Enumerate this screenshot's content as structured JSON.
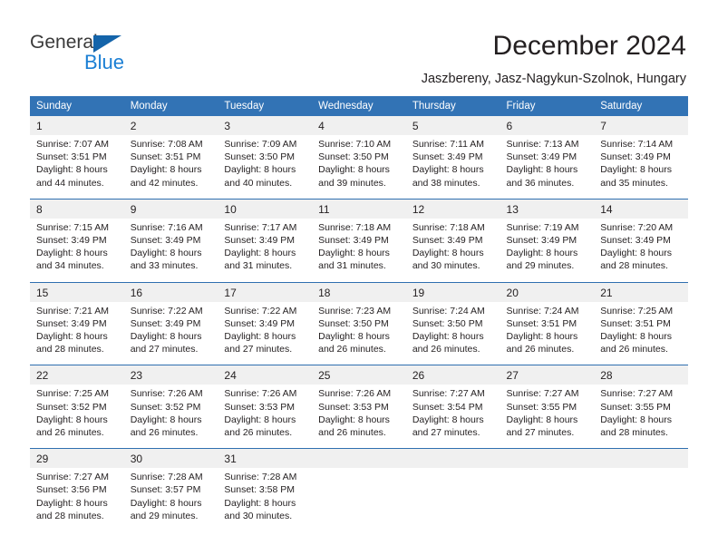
{
  "brand": {
    "name_part1": "General",
    "name_part2": "Blue",
    "triangle_color": "#1464aa",
    "blue_color": "#1b7fd4"
  },
  "header": {
    "title": "December 2024",
    "subtitle": "Jaszbereny, Jasz-Nagykun-Szolnok, Hungary"
  },
  "theme": {
    "header_bg": "#3273b5",
    "daynum_bg": "#f0f0f0",
    "rule_color": "#2f6fb0"
  },
  "calendar": {
    "weekdays": [
      "Sunday",
      "Monday",
      "Tuesday",
      "Wednesday",
      "Thursday",
      "Friday",
      "Saturday"
    ],
    "weeks": [
      [
        {
          "day": "1",
          "sunrise": "Sunrise: 7:07 AM",
          "sunset": "Sunset: 3:51 PM",
          "daylight1": "Daylight: 8 hours",
          "daylight2": "and 44 minutes."
        },
        {
          "day": "2",
          "sunrise": "Sunrise: 7:08 AM",
          "sunset": "Sunset: 3:51 PM",
          "daylight1": "Daylight: 8 hours",
          "daylight2": "and 42 minutes."
        },
        {
          "day": "3",
          "sunrise": "Sunrise: 7:09 AM",
          "sunset": "Sunset: 3:50 PM",
          "daylight1": "Daylight: 8 hours",
          "daylight2": "and 40 minutes."
        },
        {
          "day": "4",
          "sunrise": "Sunrise: 7:10 AM",
          "sunset": "Sunset: 3:50 PM",
          "daylight1": "Daylight: 8 hours",
          "daylight2": "and 39 minutes."
        },
        {
          "day": "5",
          "sunrise": "Sunrise: 7:11 AM",
          "sunset": "Sunset: 3:49 PM",
          "daylight1": "Daylight: 8 hours",
          "daylight2": "and 38 minutes."
        },
        {
          "day": "6",
          "sunrise": "Sunrise: 7:13 AM",
          "sunset": "Sunset: 3:49 PM",
          "daylight1": "Daylight: 8 hours",
          "daylight2": "and 36 minutes."
        },
        {
          "day": "7",
          "sunrise": "Sunrise: 7:14 AM",
          "sunset": "Sunset: 3:49 PM",
          "daylight1": "Daylight: 8 hours",
          "daylight2": "and 35 minutes."
        }
      ],
      [
        {
          "day": "8",
          "sunrise": "Sunrise: 7:15 AM",
          "sunset": "Sunset: 3:49 PM",
          "daylight1": "Daylight: 8 hours",
          "daylight2": "and 34 minutes."
        },
        {
          "day": "9",
          "sunrise": "Sunrise: 7:16 AM",
          "sunset": "Sunset: 3:49 PM",
          "daylight1": "Daylight: 8 hours",
          "daylight2": "and 33 minutes."
        },
        {
          "day": "10",
          "sunrise": "Sunrise: 7:17 AM",
          "sunset": "Sunset: 3:49 PM",
          "daylight1": "Daylight: 8 hours",
          "daylight2": "and 31 minutes."
        },
        {
          "day": "11",
          "sunrise": "Sunrise: 7:18 AM",
          "sunset": "Sunset: 3:49 PM",
          "daylight1": "Daylight: 8 hours",
          "daylight2": "and 31 minutes."
        },
        {
          "day": "12",
          "sunrise": "Sunrise: 7:18 AM",
          "sunset": "Sunset: 3:49 PM",
          "daylight1": "Daylight: 8 hours",
          "daylight2": "and 30 minutes."
        },
        {
          "day": "13",
          "sunrise": "Sunrise: 7:19 AM",
          "sunset": "Sunset: 3:49 PM",
          "daylight1": "Daylight: 8 hours",
          "daylight2": "and 29 minutes."
        },
        {
          "day": "14",
          "sunrise": "Sunrise: 7:20 AM",
          "sunset": "Sunset: 3:49 PM",
          "daylight1": "Daylight: 8 hours",
          "daylight2": "and 28 minutes."
        }
      ],
      [
        {
          "day": "15",
          "sunrise": "Sunrise: 7:21 AM",
          "sunset": "Sunset: 3:49 PM",
          "daylight1": "Daylight: 8 hours",
          "daylight2": "and 28 minutes."
        },
        {
          "day": "16",
          "sunrise": "Sunrise: 7:22 AM",
          "sunset": "Sunset: 3:49 PM",
          "daylight1": "Daylight: 8 hours",
          "daylight2": "and 27 minutes."
        },
        {
          "day": "17",
          "sunrise": "Sunrise: 7:22 AM",
          "sunset": "Sunset: 3:49 PM",
          "daylight1": "Daylight: 8 hours",
          "daylight2": "and 27 minutes."
        },
        {
          "day": "18",
          "sunrise": "Sunrise: 7:23 AM",
          "sunset": "Sunset: 3:50 PM",
          "daylight1": "Daylight: 8 hours",
          "daylight2": "and 26 minutes."
        },
        {
          "day": "19",
          "sunrise": "Sunrise: 7:24 AM",
          "sunset": "Sunset: 3:50 PM",
          "daylight1": "Daylight: 8 hours",
          "daylight2": "and 26 minutes."
        },
        {
          "day": "20",
          "sunrise": "Sunrise: 7:24 AM",
          "sunset": "Sunset: 3:51 PM",
          "daylight1": "Daylight: 8 hours",
          "daylight2": "and 26 minutes."
        },
        {
          "day": "21",
          "sunrise": "Sunrise: 7:25 AM",
          "sunset": "Sunset: 3:51 PM",
          "daylight1": "Daylight: 8 hours",
          "daylight2": "and 26 minutes."
        }
      ],
      [
        {
          "day": "22",
          "sunrise": "Sunrise: 7:25 AM",
          "sunset": "Sunset: 3:52 PM",
          "daylight1": "Daylight: 8 hours",
          "daylight2": "and 26 minutes."
        },
        {
          "day": "23",
          "sunrise": "Sunrise: 7:26 AM",
          "sunset": "Sunset: 3:52 PM",
          "daylight1": "Daylight: 8 hours",
          "daylight2": "and 26 minutes."
        },
        {
          "day": "24",
          "sunrise": "Sunrise: 7:26 AM",
          "sunset": "Sunset: 3:53 PM",
          "daylight1": "Daylight: 8 hours",
          "daylight2": "and 26 minutes."
        },
        {
          "day": "25",
          "sunrise": "Sunrise: 7:26 AM",
          "sunset": "Sunset: 3:53 PM",
          "daylight1": "Daylight: 8 hours",
          "daylight2": "and 26 minutes."
        },
        {
          "day": "26",
          "sunrise": "Sunrise: 7:27 AM",
          "sunset": "Sunset: 3:54 PM",
          "daylight1": "Daylight: 8 hours",
          "daylight2": "and 27 minutes."
        },
        {
          "day": "27",
          "sunrise": "Sunrise: 7:27 AM",
          "sunset": "Sunset: 3:55 PM",
          "daylight1": "Daylight: 8 hours",
          "daylight2": "and 27 minutes."
        },
        {
          "day": "28",
          "sunrise": "Sunrise: 7:27 AM",
          "sunset": "Sunset: 3:55 PM",
          "daylight1": "Daylight: 8 hours",
          "daylight2": "and 28 minutes."
        }
      ],
      [
        {
          "day": "29",
          "sunrise": "Sunrise: 7:27 AM",
          "sunset": "Sunset: 3:56 PM",
          "daylight1": "Daylight: 8 hours",
          "daylight2": "and 28 minutes."
        },
        {
          "day": "30",
          "sunrise": "Sunrise: 7:28 AM",
          "sunset": "Sunset: 3:57 PM",
          "daylight1": "Daylight: 8 hours",
          "daylight2": "and 29 minutes."
        },
        {
          "day": "31",
          "sunrise": "Sunrise: 7:28 AM",
          "sunset": "Sunset: 3:58 PM",
          "daylight1": "Daylight: 8 hours",
          "daylight2": "and 30 minutes."
        },
        {
          "day": "",
          "sunrise": "",
          "sunset": "",
          "daylight1": "",
          "daylight2": ""
        },
        {
          "day": "",
          "sunrise": "",
          "sunset": "",
          "daylight1": "",
          "daylight2": ""
        },
        {
          "day": "",
          "sunrise": "",
          "sunset": "",
          "daylight1": "",
          "daylight2": ""
        },
        {
          "day": "",
          "sunrise": "",
          "sunset": "",
          "daylight1": "",
          "daylight2": ""
        }
      ]
    ]
  }
}
